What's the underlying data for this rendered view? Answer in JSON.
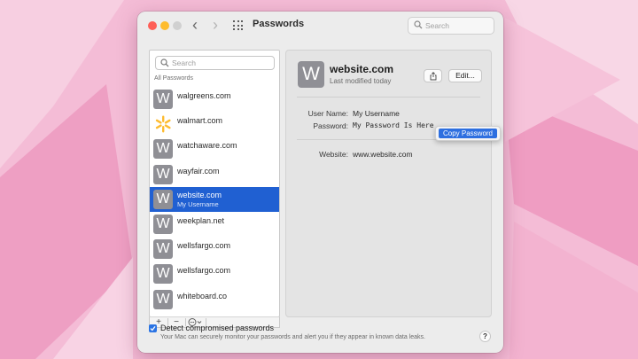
{
  "window": {
    "title": "Passwords",
    "search_placeholder": "Search"
  },
  "sidebar": {
    "search_placeholder": "Search",
    "section_label": "All Passwords",
    "items": [
      {
        "site": "walgreens.com",
        "avatar": "W",
        "icon": "letter-avatar"
      },
      {
        "site": "walmart.com",
        "avatar": "",
        "icon": "walmart-spark-icon"
      },
      {
        "site": "watchaware.com",
        "avatar": "W",
        "icon": "letter-avatar"
      },
      {
        "site": "wayfair.com",
        "avatar": "W",
        "icon": "letter-avatar"
      },
      {
        "site": "website.com",
        "user": "My Username",
        "avatar": "W",
        "icon": "letter-avatar",
        "selected": true
      },
      {
        "site": "weekplan.net",
        "avatar": "W",
        "icon": "letter-avatar"
      },
      {
        "site": "wellsfargo.com",
        "avatar": "W",
        "icon": "letter-avatar"
      },
      {
        "site": "wellsfargo.com",
        "avatar": "W",
        "icon": "letter-avatar"
      },
      {
        "site": "whiteboard.co",
        "avatar": "W",
        "icon": "letter-avatar"
      }
    ],
    "footer": {
      "add": "+",
      "remove": "−"
    }
  },
  "detail": {
    "avatar": "W",
    "title": "website.com",
    "subtitle": "Last modified today",
    "edit_label": "Edit...",
    "user_name_label": "User Name:",
    "user_name_value": "My Username",
    "password_label": "Password:",
    "password_value": "My Password Is Here",
    "website_label": "Website:",
    "website_value": "www.website.com"
  },
  "popup": {
    "copy_password": "Copy Password"
  },
  "bottom": {
    "detect_label": "Detect compromised passwords",
    "detect_help": "Your Mac can securely monitor your passwords and alert you if they appear in known data leaks.",
    "detect_checked": true,
    "help": "?"
  },
  "colors": {
    "selection": "#2060d2",
    "accent": "#2b74e4",
    "walmart_yellow": "#fdbb30",
    "avatar_gray": "#8f8f95"
  }
}
